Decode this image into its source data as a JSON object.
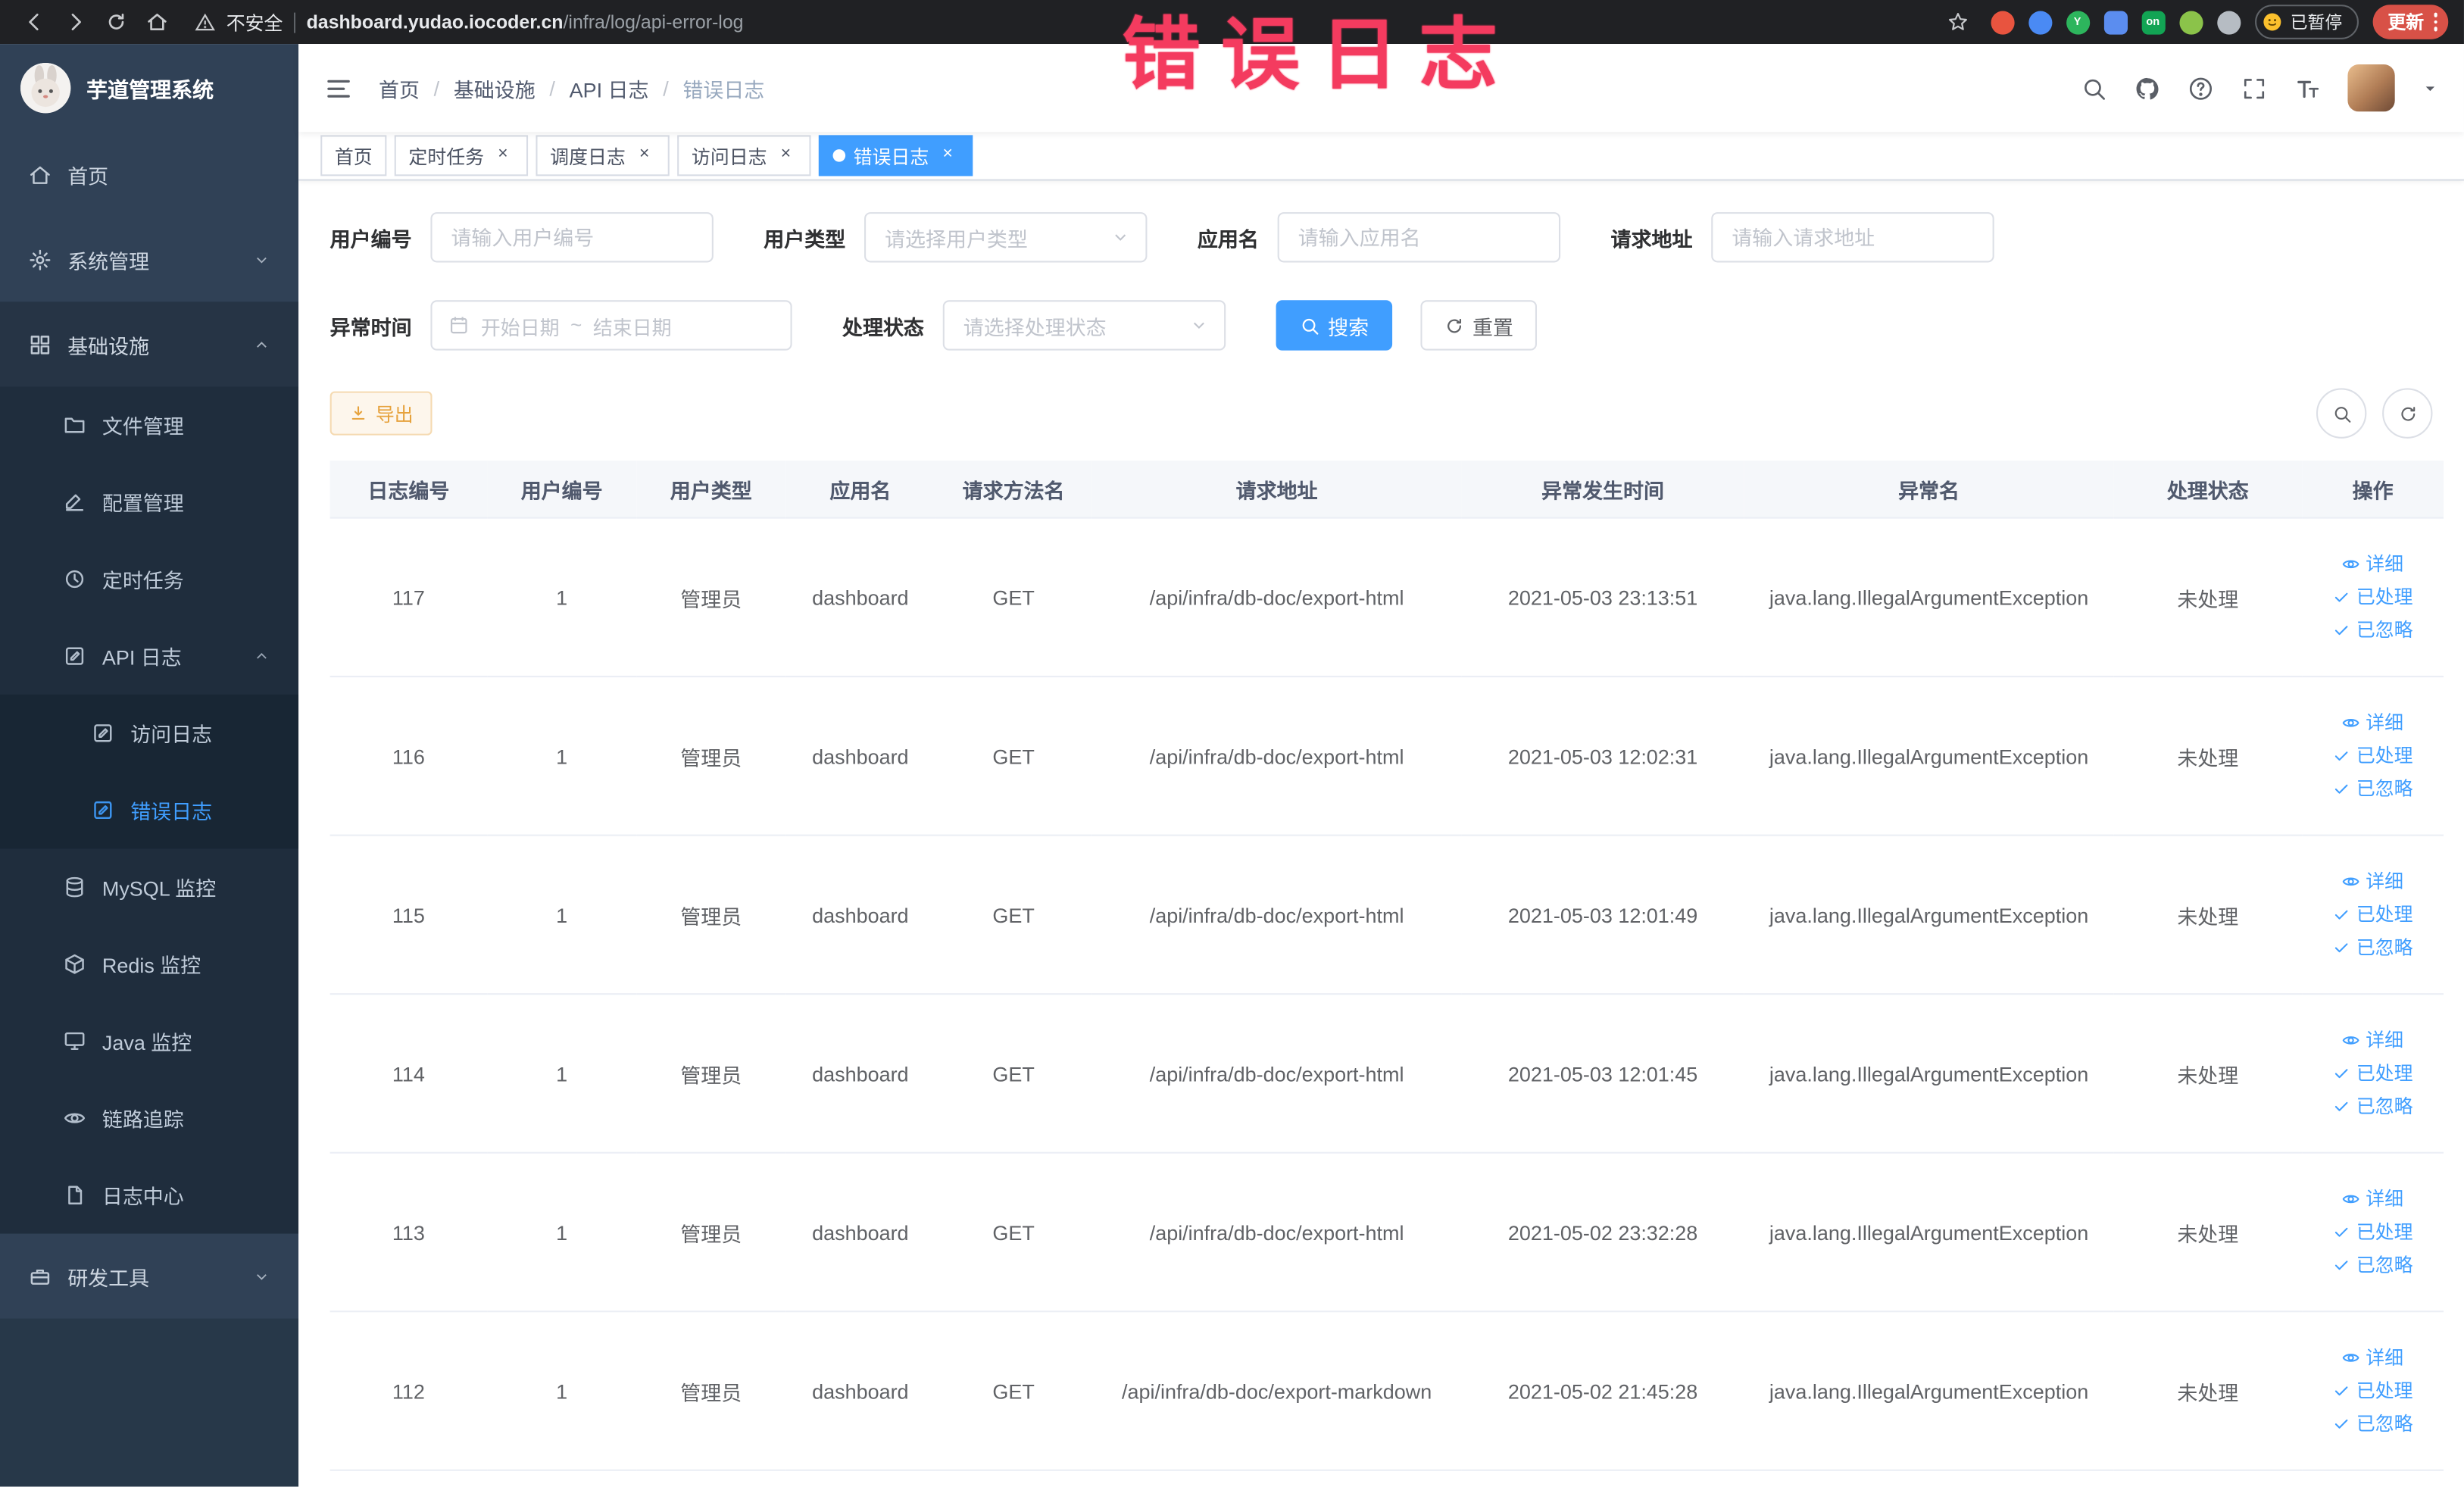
{
  "colors": {
    "accent": "#409eff",
    "sidebar_bg": "#304156",
    "submenu_bg": "#1f2d3d",
    "active_tag_bg": "#409eff",
    "annotation_red": "#f43b5f",
    "export_warning_text": "#e6a23c",
    "update_button_bg": "#d85147"
  },
  "annotation": {
    "text": "错误日志"
  },
  "browser": {
    "security_label": "不安全",
    "url_domain": "dashboard.yudao.iocoder.cn",
    "url_path": "/infra/log/api-error-log",
    "paused_badge": "已暂停",
    "update_label": "更新",
    "extensions": [
      {
        "name": "extension-red-circle-icon",
        "color": "#e8543f",
        "shape": "circle",
        "glyph": ""
      },
      {
        "name": "extension-blue-drop-icon",
        "color": "#4a8af4",
        "shape": "circle",
        "glyph": ""
      },
      {
        "name": "extension-green-circle-icon",
        "color": "#2db55d",
        "shape": "circle",
        "glyph": "Y"
      },
      {
        "name": "extension-blue-grid-icon",
        "color": "#5b8def",
        "shape": "square",
        "glyph": ""
      },
      {
        "name": "extension-on-badge-icon",
        "color": "#12a454",
        "shape": "square",
        "glyph": "on"
      },
      {
        "name": "extension-leaf-icon",
        "color": "#8bc34a",
        "shape": "circle",
        "glyph": ""
      },
      {
        "name": "extension-paw-icon",
        "color": "#b6bcc3",
        "shape": "circle",
        "glyph": ""
      }
    ]
  },
  "sidebar": {
    "title": "芋道管理系统",
    "home": "首页",
    "system_mgmt": "系统管理",
    "infrastructure": "基础设施",
    "file_mgmt": "文件管理",
    "config_mgmt": "配置管理",
    "scheduled_jobs": "定时任务",
    "api_log": "API 日志",
    "access_log": "访问日志",
    "error_log": "错误日志",
    "mysql_monitor": "MySQL 监控",
    "redis_monitor": "Redis 监控",
    "java_monitor": "Java 监控",
    "trace": "链路追踪",
    "log_center": "日志中心",
    "dev_tools": "研发工具"
  },
  "breadcrumb": [
    "首页",
    "基础设施",
    "API 日志",
    "错误日志"
  ],
  "tags": [
    {
      "label": "首页",
      "active": false,
      "closable": false
    },
    {
      "label": "定时任务",
      "active": false,
      "closable": true
    },
    {
      "label": "调度日志",
      "active": false,
      "closable": true
    },
    {
      "label": "访问日志",
      "active": false,
      "closable": true
    },
    {
      "label": "错误日志",
      "active": true,
      "closable": true
    }
  ],
  "filters": {
    "user_id": {
      "label": "用户编号",
      "placeholder": "请输入用户编号"
    },
    "user_type": {
      "label": "用户类型",
      "placeholder": "请选择用户类型"
    },
    "app_name": {
      "label": "应用名",
      "placeholder": "请输入应用名"
    },
    "request_url": {
      "label": "请求地址",
      "placeholder": "请输入请求地址"
    },
    "exception_time": {
      "label": "异常时间",
      "start_placeholder": "开始日期",
      "separator": "~",
      "end_placeholder": "结束日期"
    },
    "process_status": {
      "label": "处理状态",
      "placeholder": "请选择处理状态"
    },
    "search_button": "搜索",
    "reset_button": "重置"
  },
  "toolbar": {
    "export_button": "导出"
  },
  "table": {
    "columns": [
      "日志编号",
      "用户编号",
      "用户类型",
      "应用名",
      "请求方法名",
      "请求地址",
      "异常发生时间",
      "异常名",
      "处理状态",
      "操作"
    ],
    "actions": [
      "详细",
      "已处理",
      "已忽略"
    ],
    "rows": [
      {
        "id": "117",
        "user_id": "1",
        "user_type": "管理员",
        "app_name": "dashboard",
        "method": "GET",
        "url": "/api/infra/db-doc/export-html",
        "time": "2021-05-03 23:13:51",
        "exception": "java.lang.IllegalArgumentException",
        "status": "未处理"
      },
      {
        "id": "116",
        "user_id": "1",
        "user_type": "管理员",
        "app_name": "dashboard",
        "method": "GET",
        "url": "/api/infra/db-doc/export-html",
        "time": "2021-05-03 12:02:31",
        "exception": "java.lang.IllegalArgumentException",
        "status": "未处理"
      },
      {
        "id": "115",
        "user_id": "1",
        "user_type": "管理员",
        "app_name": "dashboard",
        "method": "GET",
        "url": "/api/infra/db-doc/export-html",
        "time": "2021-05-03 12:01:49",
        "exception": "java.lang.IllegalArgumentException",
        "status": "未处理"
      },
      {
        "id": "114",
        "user_id": "1",
        "user_type": "管理员",
        "app_name": "dashboard",
        "method": "GET",
        "url": "/api/infra/db-doc/export-html",
        "time": "2021-05-03 12:01:45",
        "exception": "java.lang.IllegalArgumentException",
        "status": "未处理"
      },
      {
        "id": "113",
        "user_id": "1",
        "user_type": "管理员",
        "app_name": "dashboard",
        "method": "GET",
        "url": "/api/infra/db-doc/export-html",
        "time": "2021-05-02 23:32:28",
        "exception": "java.lang.IllegalArgumentException",
        "status": "未处理"
      },
      {
        "id": "112",
        "user_id": "1",
        "user_type": "管理员",
        "app_name": "dashboard",
        "method": "GET",
        "url": "/api/infra/db-doc/export-markdown",
        "time": "2021-05-02 21:45:28",
        "exception": "java.lang.IllegalArgumentException",
        "status": "未处理"
      }
    ]
  }
}
